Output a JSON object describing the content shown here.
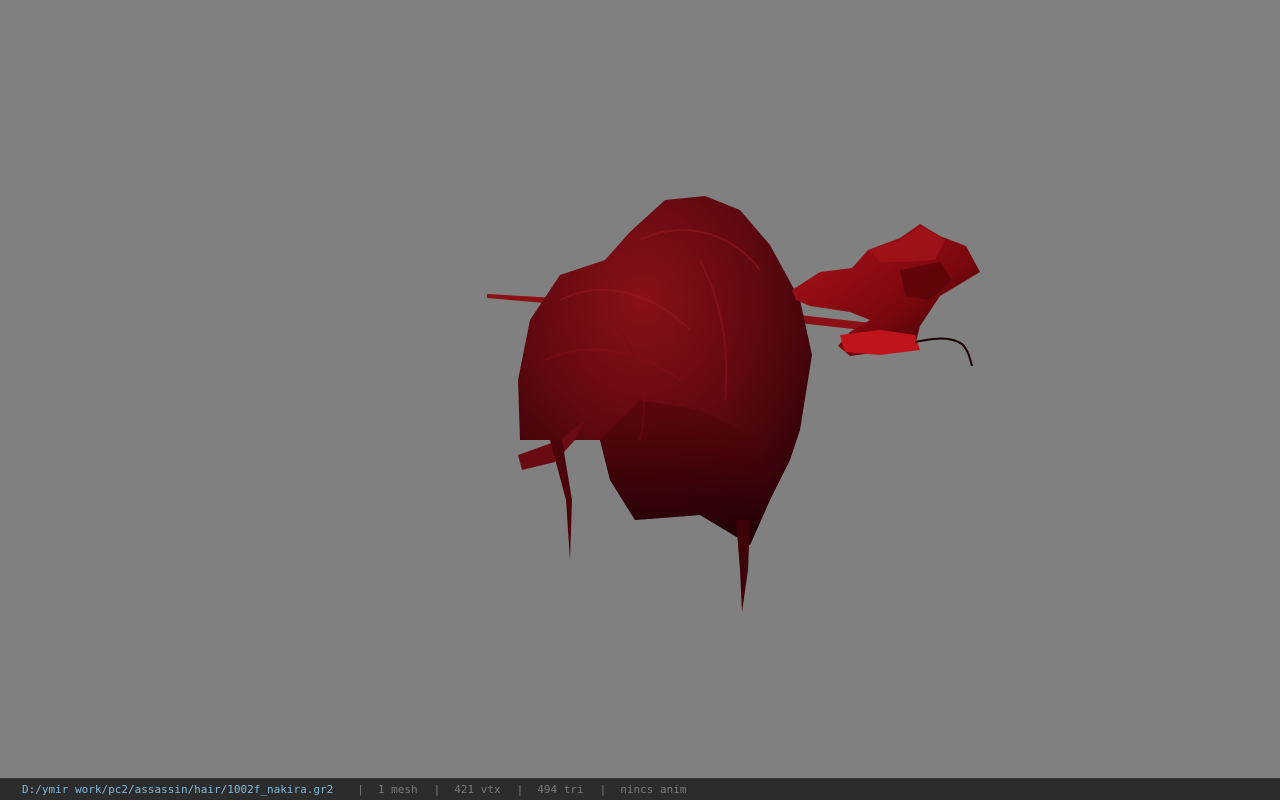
{
  "viewer": {
    "background_color": "#808080",
    "model": {
      "kind": "3d-hair-mesh",
      "base_color": "#7a0a12",
      "shadow_color": "#2a0004"
    }
  },
  "status_bar": {
    "file_path": "D:/ymir work/pc2/assassin/hair/1002f_nakira.gr2",
    "separator": "|",
    "mesh_count": "1 mesh",
    "vertex_count": "421 vtx",
    "triangle_count": "494 tri",
    "flags": "nincs anim"
  }
}
